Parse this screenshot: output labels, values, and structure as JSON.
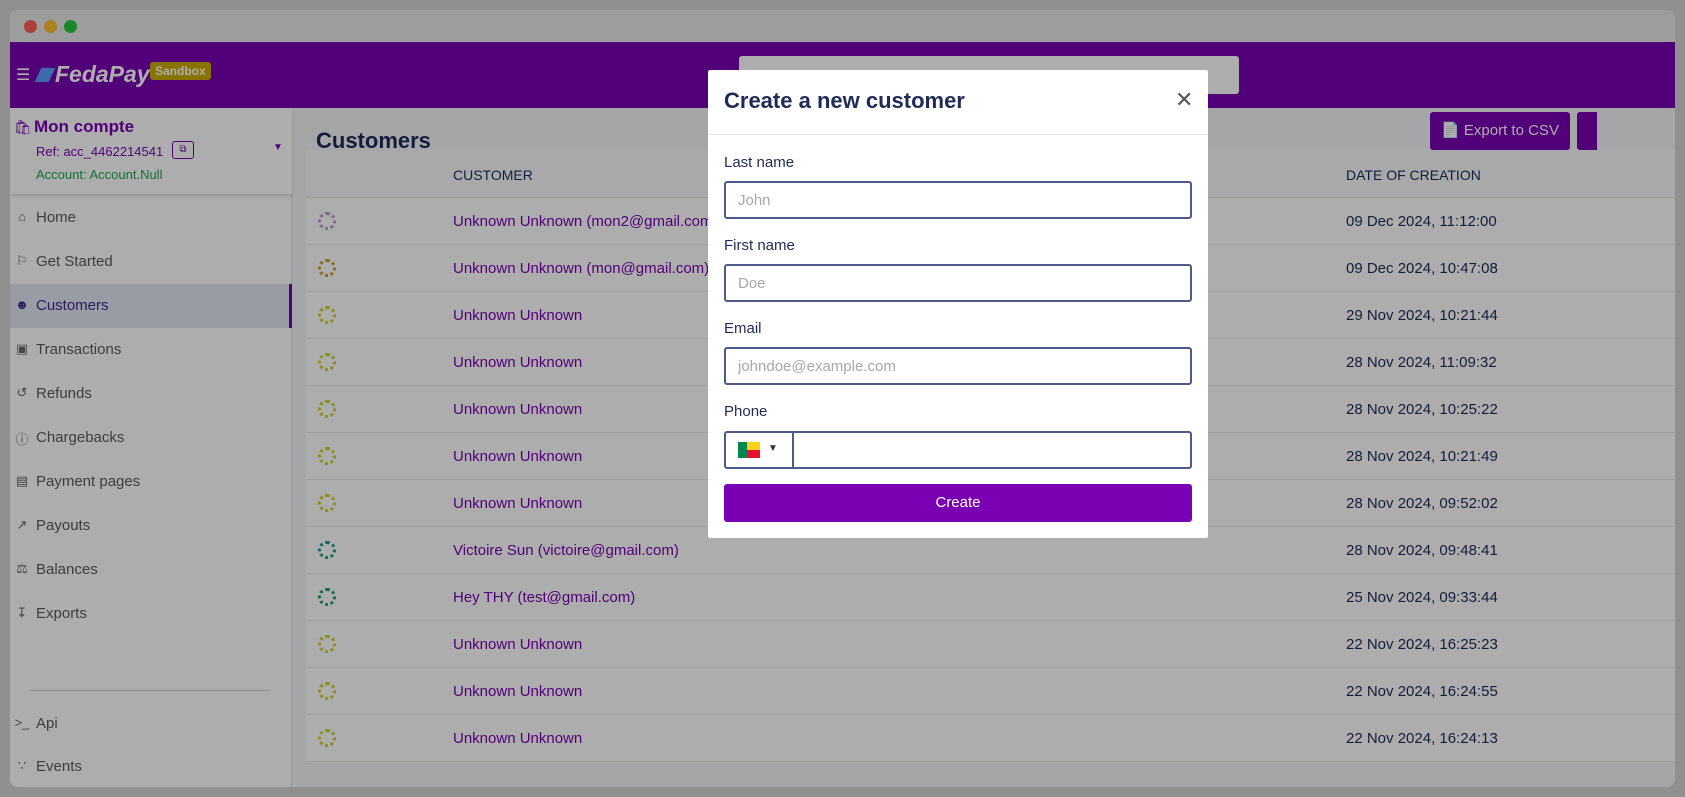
{
  "app": {
    "brand": "FedaPay",
    "env_badge": "Sandbox"
  },
  "account": {
    "name": "Mon compte",
    "ref": "Ref: acc_4462214541",
    "account_label": "Account: Account.Null"
  },
  "sidebar": {
    "items": [
      {
        "label": "Home",
        "icon": "home-icon"
      },
      {
        "label": "Get Started",
        "icon": "flag-icon"
      },
      {
        "label": "Customers",
        "icon": "user-circle-icon",
        "active": true
      },
      {
        "label": "Transactions",
        "icon": "cash-icon"
      },
      {
        "label": "Refunds",
        "icon": "refund-icon"
      },
      {
        "label": "Chargebacks",
        "icon": "alert-circle-icon"
      },
      {
        "label": "Payment pages",
        "icon": "document-icon"
      },
      {
        "label": "Payouts",
        "icon": "external-link-icon"
      },
      {
        "label": "Balances",
        "icon": "scale-icon"
      },
      {
        "label": "Exports",
        "icon": "download-icon"
      },
      {
        "label": "Api",
        "icon": "terminal-icon"
      },
      {
        "label": "Events",
        "icon": "rss-icon"
      }
    ]
  },
  "main": {
    "title": "Customers",
    "export_label": "Export to CSV",
    "columns": {
      "customer": "CUSTOMER",
      "date": "DATE OF CREATION"
    },
    "rows": [
      {
        "customer": "Unknown Unknown (mon2@gmail.com)",
        "date": "09 Dec 2024, 11:12:00",
        "avatar_color": "#b39ddb"
      },
      {
        "customer": "Unknown Unknown (mon@gmail.com)",
        "date": "09 Dec 2024, 10:47:08",
        "avatar_color": "#c9a227"
      },
      {
        "customer": "Unknown Unknown",
        "date": "29 Nov 2024, 10:21:44",
        "avatar_color": "#c6d620"
      },
      {
        "customer": "Unknown Unknown",
        "date": "28 Nov 2024, 11:09:32",
        "avatar_color": "#c6d620"
      },
      {
        "customer": "Unknown Unknown",
        "date": "28 Nov 2024, 10:25:22",
        "avatar_color": "#c6d620"
      },
      {
        "customer": "Unknown Unknown",
        "date": "28 Nov 2024, 10:21:49",
        "avatar_color": "#c6d620"
      },
      {
        "customer": "Unknown Unknown",
        "date": "28 Nov 2024, 09:52:02",
        "avatar_color": "#c6d620"
      },
      {
        "customer": "Victoire Sun (victoire@gmail.com)",
        "date": "28 Nov 2024, 09:48:41",
        "avatar_color": "#1f9e89"
      },
      {
        "customer": "Hey THY (test@gmail.com)",
        "date": "25 Nov 2024, 09:33:44",
        "avatar_color": "#1f9e6a"
      },
      {
        "customer": "Unknown Unknown",
        "date": "22 Nov 2024, 16:25:23",
        "avatar_color": "#c6d620"
      },
      {
        "customer": "Unknown Unknown",
        "date": "22 Nov 2024, 16:24:55",
        "avatar_color": "#c6d620"
      },
      {
        "customer": "Unknown Unknown",
        "date": "22 Nov 2024, 16:24:13",
        "avatar_color": "#c6d620"
      }
    ]
  },
  "modal": {
    "title": "Create a new customer",
    "last_name_label": "Last name",
    "last_name_placeholder": "John",
    "first_name_label": "First name",
    "first_name_placeholder": "Doe",
    "email_label": "Email",
    "email_placeholder": "johndoe@example.com",
    "phone_label": "Phone",
    "phone_value": "",
    "create_label": "Create"
  },
  "colors": {
    "brand": "#7a00b3",
    "badge": "#c9a900",
    "active_nav_bg": "#e3e6f3",
    "success": "#19a84a"
  }
}
